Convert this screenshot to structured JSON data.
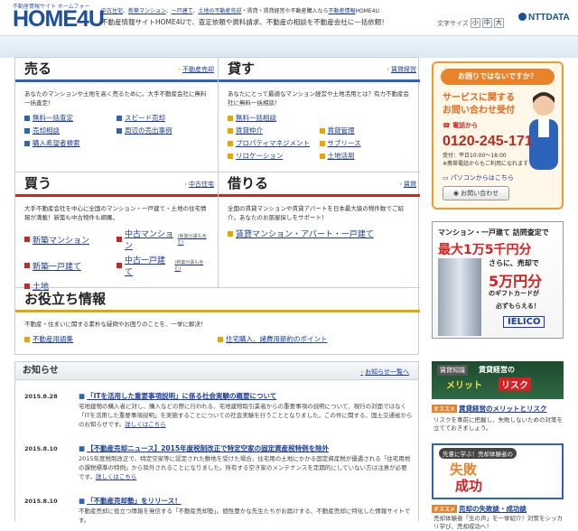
{
  "header": {
    "tagline_small": "不動産情報サイト ホームフォー",
    "logo": "HOME4U",
    "links": [
      "中古住宅",
      "新築マンション",
      "一戸建て",
      "土地",
      "の不動産売却",
      "・賃貸・賃貸経営",
      "や不動産購入なら",
      "不動産情報",
      "HOME4U"
    ],
    "description": "不動産情報サイトHOME4Uで、査定依頼や資料請求、不動産の相談を不動産会社に一括依頼！",
    "font_size_label": "文字サイズ",
    "font_sizes": [
      "小",
      "中",
      "大"
    ],
    "ntt": "NTTDATA"
  },
  "sell": {
    "title": "売る",
    "more": "不動産売却",
    "desc": "あなたのマンションや土地を高く売るために。大手不動産会社に無料一括査定！",
    "links": [
      "無料一括査定",
      "スピード売却",
      "売却相談",
      "周辺の売出事例",
      "購入希望者検索"
    ]
  },
  "lend": {
    "title": "貸す",
    "more": "賃貸経営",
    "desc": "あなたにとって最適なマンション経営や土地活用とは？有力不動産会社に無料一括相談！",
    "links": [
      "無料一括相談",
      "賃貸仲介",
      "賃貸管理",
      "プロパティマネジメント",
      "サブリース",
      "リロケーション",
      "土地活用"
    ]
  },
  "buy": {
    "title": "買う",
    "more": "中古住宅",
    "desc": "大手不動産会社を中心に全国のマンション・一戸建て・土地の住宅情報が満載！新築も中古物件も網羅。",
    "links": [
      "新築マンション",
      "中古マンション",
      "新築一戸建て",
      "中古一戸建て",
      "土地"
    ],
    "note": "(新築分譲も含む)"
  },
  "rent": {
    "title": "借りる",
    "more": "賃貸",
    "desc": "全国の賃貸マンションや賃貸アパートを日本最大級の物件数でご紹介。あなたのお部屋探しをサポート！",
    "links": [
      "賃貸マンション・アパート・一戸建て"
    ]
  },
  "useful": {
    "title": "お役立ち情報",
    "desc": "不動産・住まいに関する素朴な疑問やお困りのことを、一挙に解決！",
    "links": [
      "不動産用語集",
      "住宅購入、諸費用節約のポイント"
    ]
  },
  "news": {
    "title": "お知らせ",
    "more": "お知らせ一覧へ",
    "items": [
      {
        "date": "2015.8.28",
        "title": "「ITを活用した重要事項説明」に係る社会実験の概要について",
        "body": "宅地建物の購入者に対し、購入などの際に行われる、宅地建物取引業者からの重要事項の説明について、現行の対面ではなく「ITを活用した重要事項説明」を実施することについての社会実験を行うこととなりました。この件に関する、国土交通省からのお知らせです。",
        "link": "詳しくはこちら"
      },
      {
        "date": "2015.8.10",
        "title": "【不動産売却ニュース】2015年度税制改正で特定空家の固定資産税特例を除外",
        "body": "2015年度税制改正で、特定空家等に認定された敷地を受けた場合、住宅用の土地にかかる固定資産税が優遇される「住宅用地の課税標準の特例」から除外されることになりました。所有する空き家のメンテナンスを定期的にしていない方は注意が必要です。",
        "link": "詳しくはこちら"
      },
      {
        "date": "2015.8.10",
        "title": "「不動産売却塾」をリリース！",
        "body": "不動産売却に役立つ情報を発信する「不動産売却塾」。個性豊かな先生たちがお届けする、不動産売却に特化した情報サイトです。",
        "link": ""
      }
    ]
  },
  "side": {
    "ad1": {
      "q": "お困りではないですか？",
      "s1a": "サービスに関する",
      "s1b": "お問い合わせ受付",
      "tel_label": "電話から",
      "tel": "0120-245-171",
      "hrs1": "受付：平日10:00〜18:00",
      "hrs2": "※携帯電話からもご利用になれます",
      "pc": "パソコンからはこちら",
      "btn": "お問い合わせ"
    },
    "ad2": {
      "l1": "マンション・一戸建て 訪問査定で",
      "l2": "最大1万5千円分",
      "l3": "さらに、売却で",
      "l4": "5万円分",
      "l5": "のギフトカードが",
      "l6": "必ずもらえる！",
      "brand": "IELICO"
    },
    "ad3": {
      "a": "賃貸知識",
      "b1": "賃貸経営の",
      "b2": "メリット",
      "b3": "リスク"
    },
    "link1": {
      "tag": "オススメ",
      "text": "賃貸経営のメリットとリスク",
      "desc": "リスクを事前に把握し、失敗しないための対策を立てておきましょう。"
    },
    "ad4": {
      "a": "先輩に学ぶ！売却体験者の",
      "b1": "失敗",
      "b2": "成功"
    },
    "link2": {
      "tag": "オススメ",
      "text": "売却の失敗談・成功談",
      "desc": "売却体験者「生の声」を一挙紹介！対策をシッカリ学び、売却成功へ！"
    }
  }
}
